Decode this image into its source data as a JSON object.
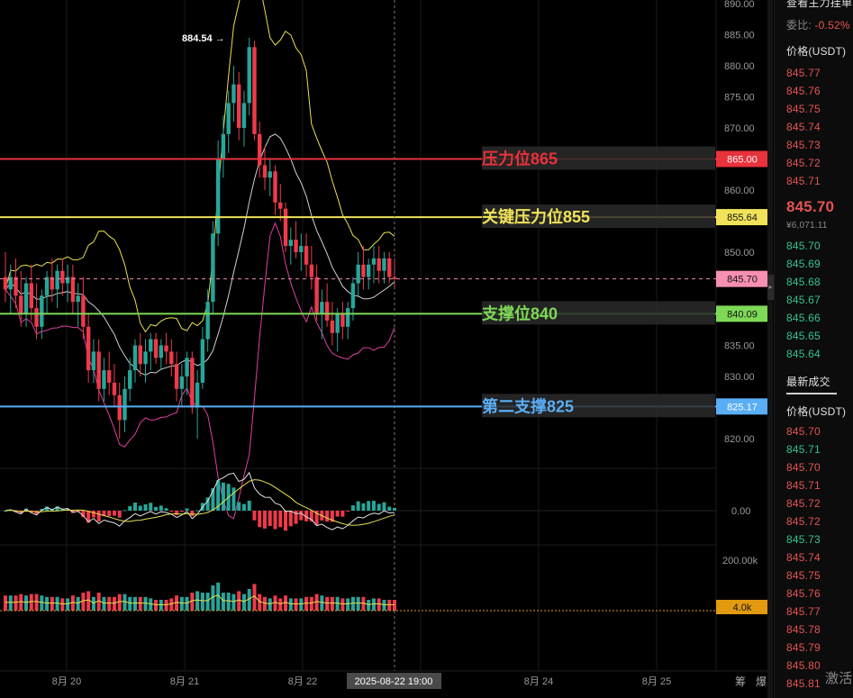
{
  "chart_data": {
    "type": "candlestick",
    "y_axis": {
      "min": 816,
      "max": 890,
      "ticks": [
        890,
        885,
        880,
        875,
        870,
        865,
        860,
        855,
        850,
        845,
        840,
        835,
        830,
        825,
        820
      ]
    },
    "x_axis": {
      "labels": [
        "8月 20",
        "8月 21",
        "8月 22",
        "8月 24",
        "8月 25"
      ],
      "crosshair_label": "2025-08-22 19:00"
    },
    "candles": [
      {
        "o": 846,
        "h": 850,
        "l": 842,
        "c": 844
      },
      {
        "o": 844,
        "h": 848,
        "l": 840,
        "c": 846
      },
      {
        "o": 846,
        "h": 849,
        "l": 841,
        "c": 843
      },
      {
        "o": 843,
        "h": 847,
        "l": 838,
        "c": 840
      },
      {
        "o": 840,
        "h": 846,
        "l": 838,
        "c": 845
      },
      {
        "o": 845,
        "h": 848,
        "l": 839,
        "c": 841
      },
      {
        "o": 841,
        "h": 845,
        "l": 836,
        "c": 838
      },
      {
        "o": 838,
        "h": 844,
        "l": 836,
        "c": 843
      },
      {
        "o": 843,
        "h": 847,
        "l": 840,
        "c": 846
      },
      {
        "o": 846,
        "h": 849,
        "l": 842,
        "c": 844
      },
      {
        "o": 844,
        "h": 848,
        "l": 841,
        "c": 847
      },
      {
        "o": 847,
        "h": 849,
        "l": 843,
        "c": 845
      },
      {
        "o": 845,
        "h": 848,
        "l": 842,
        "c": 846
      },
      {
        "o": 846,
        "h": 848,
        "l": 840,
        "c": 842
      },
      {
        "o": 842,
        "h": 845,
        "l": 838,
        "c": 843
      },
      {
        "o": 843,
        "h": 846,
        "l": 836,
        "c": 838
      },
      {
        "o": 838,
        "h": 840,
        "l": 829,
        "c": 831
      },
      {
        "o": 831,
        "h": 836,
        "l": 829,
        "c": 834
      },
      {
        "o": 834,
        "h": 836,
        "l": 826,
        "c": 828
      },
      {
        "o": 828,
        "h": 833,
        "l": 826,
        "c": 831
      },
      {
        "o": 831,
        "h": 834,
        "l": 827,
        "c": 829
      },
      {
        "o": 829,
        "h": 832,
        "l": 825,
        "c": 827
      },
      {
        "o": 827,
        "h": 829,
        "l": 820,
        "c": 823
      },
      {
        "o": 823,
        "h": 830,
        "l": 821,
        "c": 828
      },
      {
        "o": 828,
        "h": 833,
        "l": 826,
        "c": 831
      },
      {
        "o": 831,
        "h": 836,
        "l": 829,
        "c": 835
      },
      {
        "o": 835,
        "h": 837,
        "l": 830,
        "c": 832
      },
      {
        "o": 832,
        "h": 836,
        "l": 829,
        "c": 834
      },
      {
        "o": 834,
        "h": 837,
        "l": 831,
        "c": 836
      },
      {
        "o": 836,
        "h": 837,
        "l": 832,
        "c": 833
      },
      {
        "o": 833,
        "h": 836,
        "l": 831,
        "c": 835
      },
      {
        "o": 835,
        "h": 837,
        "l": 832,
        "c": 834
      },
      {
        "o": 834,
        "h": 836,
        "l": 830,
        "c": 832
      },
      {
        "o": 832,
        "h": 834,
        "l": 826,
        "c": 828
      },
      {
        "o": 828,
        "h": 832,
        "l": 825,
        "c": 830
      },
      {
        "o": 830,
        "h": 834,
        "l": 827,
        "c": 833
      },
      {
        "o": 833,
        "h": 834,
        "l": 824,
        "c": 825
      },
      {
        "o": 825,
        "h": 831,
        "l": 820,
        "c": 829
      },
      {
        "o": 829,
        "h": 838,
        "l": 828,
        "c": 836
      },
      {
        "o": 836,
        "h": 844,
        "l": 834,
        "c": 842
      },
      {
        "o": 842,
        "h": 855,
        "l": 840,
        "c": 853
      },
      {
        "o": 853,
        "h": 868,
        "l": 851,
        "c": 865
      },
      {
        "o": 865,
        "h": 872,
        "l": 862,
        "c": 869
      },
      {
        "o": 869,
        "h": 876,
        "l": 866,
        "c": 874
      },
      {
        "o": 874,
        "h": 880,
        "l": 871,
        "c": 877
      },
      {
        "o": 877,
        "h": 879,
        "l": 868,
        "c": 870
      },
      {
        "o": 870,
        "h": 876,
        "l": 867,
        "c": 874
      },
      {
        "o": 874,
        "h": 884.5,
        "l": 872,
        "c": 883
      },
      {
        "o": 883,
        "h": 884,
        "l": 868,
        "c": 869
      },
      {
        "o": 869,
        "h": 871,
        "l": 862,
        "c": 864
      },
      {
        "o": 864,
        "h": 867,
        "l": 860,
        "c": 862
      },
      {
        "o": 862,
        "h": 865,
        "l": 859,
        "c": 863
      },
      {
        "o": 863,
        "h": 864,
        "l": 856,
        "c": 858
      },
      {
        "o": 858,
        "h": 861,
        "l": 855,
        "c": 857
      },
      {
        "o": 857,
        "h": 858,
        "l": 850,
        "c": 851
      },
      {
        "o": 851,
        "h": 854,
        "l": 848,
        "c": 852
      },
      {
        "o": 852,
        "h": 855,
        "l": 849,
        "c": 850
      },
      {
        "o": 850,
        "h": 853,
        "l": 847,
        "c": 851
      },
      {
        "o": 851,
        "h": 853,
        "l": 846,
        "c": 848
      },
      {
        "o": 848,
        "h": 851,
        "l": 844,
        "c": 846
      },
      {
        "o": 846,
        "h": 848,
        "l": 839,
        "c": 840
      },
      {
        "o": 840,
        "h": 844,
        "l": 836,
        "c": 842
      },
      {
        "o": 842,
        "h": 845,
        "l": 838,
        "c": 839
      },
      {
        "o": 839,
        "h": 842,
        "l": 835,
        "c": 837
      },
      {
        "o": 837,
        "h": 841,
        "l": 834,
        "c": 840
      },
      {
        "o": 840,
        "h": 842,
        "l": 836,
        "c": 838
      },
      {
        "o": 838,
        "h": 842,
        "l": 836,
        "c": 841
      },
      {
        "o": 841,
        "h": 846,
        "l": 839,
        "c": 845
      },
      {
        "o": 845,
        "h": 850,
        "l": 843,
        "c": 848
      },
      {
        "o": 848,
        "h": 851,
        "l": 844,
        "c": 846
      },
      {
        "o": 846,
        "h": 849,
        "l": 844,
        "c": 848
      },
      {
        "o": 848,
        "h": 851,
        "l": 845,
        "c": 849
      },
      {
        "o": 849,
        "h": 851,
        "l": 845,
        "c": 847
      },
      {
        "o": 847,
        "h": 850,
        "l": 845,
        "c": 849
      },
      {
        "o": 849,
        "h": 850,
        "l": 845,
        "c": 846
      },
      {
        "o": 846,
        "h": 849,
        "l": 844,
        "c": 845.7
      }
    ],
    "price_line": 845.7,
    "high_marker": "884.54",
    "levels": [
      {
        "label": "压力位865",
        "value": 865.0,
        "tag": "865.00",
        "color": "#e8323c"
      },
      {
        "label": "关键压力位855",
        "value": 855.64,
        "tag": "855.64",
        "color": "#f0e35a"
      },
      {
        "label": "支撑位840",
        "value": 840.09,
        "tag": "840.09",
        "color": "#7ed957"
      },
      {
        "label": "第二支撑825",
        "value": 825.17,
        "tag": "825.17",
        "color": "#5aaef5"
      }
    ],
    "current_tag": "845.70",
    "macd_zero_label": "0.00",
    "volume_axis_label": "200.00k",
    "volume_tag": "4.0k"
  },
  "orderbook": {
    "header_title": "查看主力挂单",
    "ratio_label": "委比:",
    "ratio_value": "-0.52%",
    "price_col": "价格(USDT)",
    "asks": [
      "845.77",
      "845.76",
      "845.75",
      "845.74",
      "845.73",
      "845.72",
      "845.71"
    ],
    "last_price": "845.70",
    "last_price_sub": "¥6,071.11",
    "bids": [
      "845.70",
      "845.69",
      "845.68",
      "845.67",
      "845.66",
      "845.65",
      "845.64"
    ],
    "trades_title": "最新成交",
    "trades_price_col": "价格(USDT)",
    "trades": [
      {
        "p": "845.70",
        "c": "red"
      },
      {
        "p": "845.71",
        "c": "green"
      },
      {
        "p": "845.70",
        "c": "red"
      },
      {
        "p": "845.71",
        "c": "red"
      },
      {
        "p": "845.72",
        "c": "red"
      },
      {
        "p": "845.72",
        "c": "red"
      },
      {
        "p": "845.73",
        "c": "green"
      },
      {
        "p": "845.74",
        "c": "red"
      },
      {
        "p": "845.75",
        "c": "red"
      },
      {
        "p": "845.76",
        "c": "red"
      },
      {
        "p": "845.77",
        "c": "red"
      },
      {
        "p": "845.78",
        "c": "red"
      },
      {
        "p": "845.79",
        "c": "red"
      },
      {
        "p": "845.80",
        "c": "red"
      },
      {
        "p": "845.81",
        "c": "red"
      }
    ],
    "side_tabs": [
      "筹",
      "爆"
    ],
    "activate_text": "激活"
  },
  "colors": {
    "up": "#26a69a",
    "down": "#ef3a4a",
    "bg": "#000000"
  }
}
